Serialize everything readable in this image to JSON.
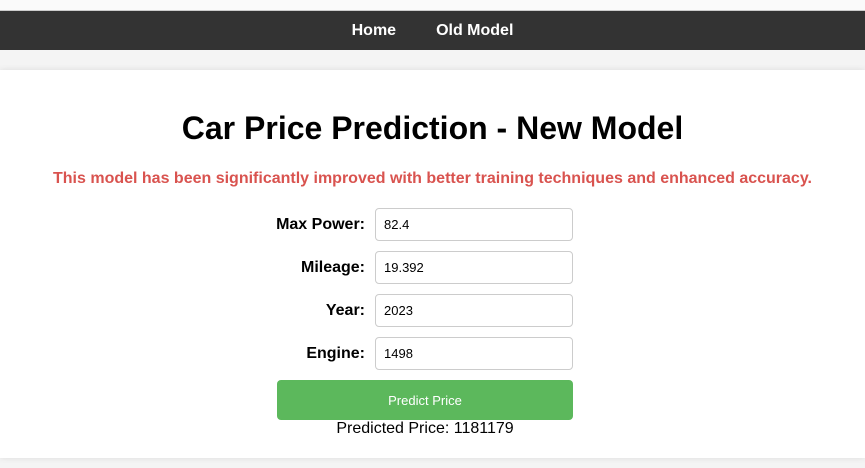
{
  "nav": {
    "home": "Home",
    "old_model": "Old Model"
  },
  "title": "Car Price Prediction - New Model",
  "subtitle": "This model has been significantly improved with better training techniques and enhanced accuracy.",
  "fields": [
    {
      "label": "Max Power:",
      "value": "82.4"
    },
    {
      "label": "Mileage:",
      "value": "19.392"
    },
    {
      "label": "Year:",
      "value": "2023"
    },
    {
      "label": "Engine:",
      "value": "1498"
    }
  ],
  "button": "Predict Price",
  "result": "Predicted Price: 1181179"
}
